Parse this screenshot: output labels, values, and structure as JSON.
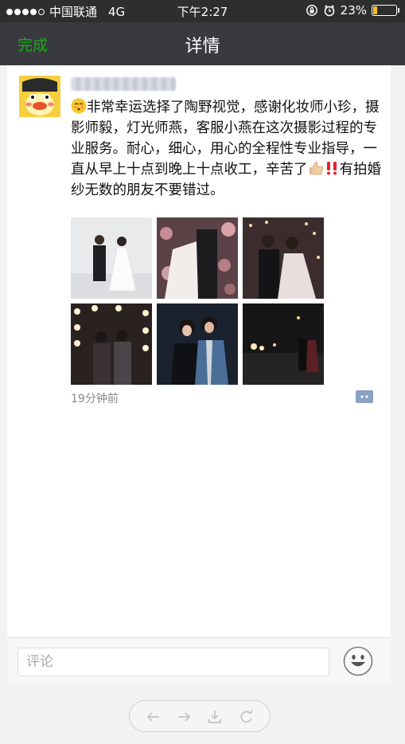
{
  "status_bar": {
    "carrier": "中国联通",
    "network": "4G",
    "time": "下午2:27",
    "battery_percent": "23%",
    "battery_level": 0.23,
    "battery_color": "#f7c21b"
  },
  "nav": {
    "done_label": "完成",
    "title": "详情"
  },
  "post": {
    "text_part1": "非常幸运选择了陶野视觉，感谢化妆师小珍，摄影师毅，灯光师燕，客服小燕在这次摄影过程的专业服务。耐心，细心，用心的全程性专业指导，一直从早上十点到晚上十点收工，辛苦了",
    "text_part2": "有拍婚纱无数的朋友不要错过。",
    "photo_count": 6,
    "time_ago": "19分钟前"
  },
  "comment_bar": {
    "placeholder": "评论"
  },
  "icons": {
    "leading_emoji": "blushing-face-icon",
    "thumbs_up": "thumbs-up-icon",
    "double_exclamation": "double-exclamation-icon",
    "comment": "comment-bubble-icon",
    "emoji_button": "smiley-icon",
    "toolbar": [
      "back-arrow-icon",
      "forward-arrow-icon",
      "download-icon",
      "refresh-icon"
    ]
  },
  "colors": {
    "accent_green": "#1aad19",
    "nav_bg": "#393a3f"
  }
}
